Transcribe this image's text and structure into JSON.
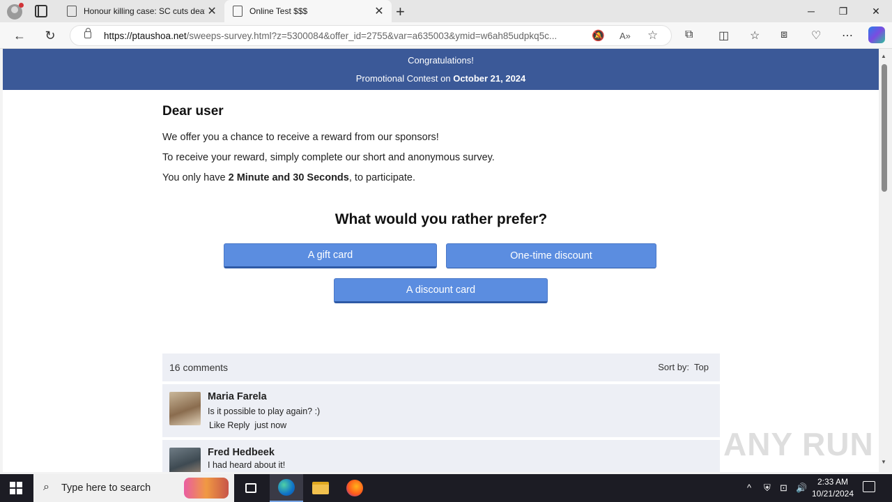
{
  "browser": {
    "tabs": [
      {
        "title": "Honour killing case: SC cuts deat"
      },
      {
        "title": "Online Test $$$"
      }
    ],
    "url_host": "https://ptaushoa.net",
    "url_path": "/sweeps-survey.html?z=5300084&offer_id=2755&var=a635003&ymid=w6ah85udpkq5c..."
  },
  "banner": {
    "line1": "Congratulations!",
    "line2_prefix": "Promotional Contest on ",
    "line2_date": "October 21, 2024"
  },
  "content": {
    "greeting": "Dear user",
    "p1": "We offer you a chance to receive a reward from our sponsors!",
    "p2": "To receive your reward, simply complete our short and anonymous survey.",
    "p3_prefix": "You only have ",
    "p3_bold": "2 Minute and 30 Seconds",
    "p3_suffix": ", to participate.",
    "question": "What would you rather prefer?",
    "choices": [
      "A gift card",
      "One-time discount",
      "A discount card"
    ]
  },
  "comments": {
    "count_label": "16 comments",
    "sort_label": "Sort by:",
    "sort_value": "Top",
    "items": [
      {
        "name": "Maria Farela",
        "text": "Is it possible to play again? :)",
        "like": "Like",
        "reply": "Reply",
        "time": "just now"
      },
      {
        "name": "Fred Hedbeek",
        "text": "I had heard about it!"
      }
    ]
  },
  "watermark": "ANY RUN",
  "taskbar": {
    "search_placeholder": "Type here to search",
    "time": "2:33 AM",
    "date": "10/21/2024"
  }
}
